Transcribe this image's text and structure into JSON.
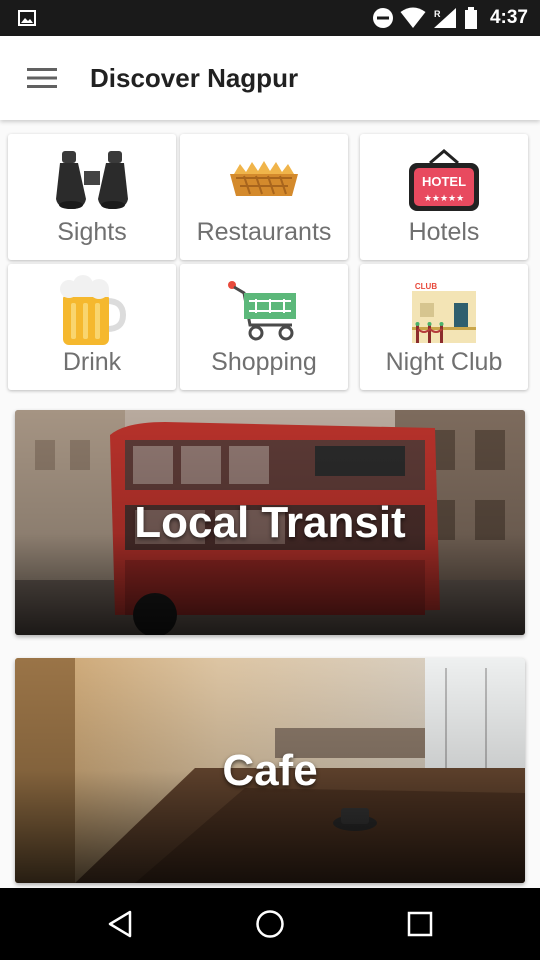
{
  "status_bar": {
    "time": "4:37",
    "icons": [
      "gallery-icon",
      "do-not-disturb-icon",
      "wifi-icon",
      "signal-roaming-icon",
      "battery-icon"
    ]
  },
  "app_bar": {
    "title": "Discover Nagpur",
    "menu_icon": "hamburger-menu-icon"
  },
  "categories": [
    {
      "label": "Sights",
      "icon": "binoculars-icon"
    },
    {
      "label": "Restaurants",
      "icon": "food-basket-icon"
    },
    {
      "label": "Hotels",
      "icon": "hotel-sign-icon"
    },
    {
      "label": "Drink",
      "icon": "beer-mug-icon"
    },
    {
      "label": "Shopping",
      "icon": "shopping-cart-icon"
    },
    {
      "label": "Night Club",
      "icon": "club-building-icon"
    }
  ],
  "banners": [
    {
      "title": "Local Transit",
      "image": "red-double-decker-bus-photo"
    },
    {
      "title": "Cafe",
      "image": "cafe-interior-photo"
    }
  ],
  "nav_bar": {
    "buttons": [
      "back-icon",
      "home-icon",
      "recents-icon"
    ]
  },
  "colors": {
    "status_bar": "#1a1a1a",
    "app_bar": "#ffffff",
    "title_text": "#212121",
    "category_text": "#707070",
    "background": "#fafafa"
  }
}
